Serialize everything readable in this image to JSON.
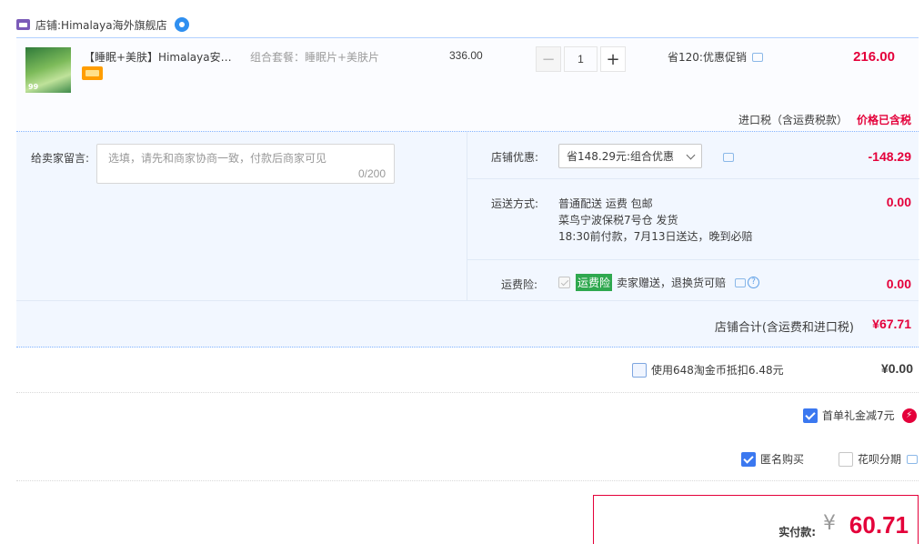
{
  "shop": {
    "prefix": "店铺:",
    "name": "Himalaya海外旗舰店"
  },
  "item": {
    "title": "【睡眠+美肤】Himalaya安神…",
    "sku": "组合套餐：睡眠片+美肤片",
    "unit_price": "336.00",
    "qty_minus": "−",
    "quantity": "1",
    "qty_plus": "+",
    "promo": "省120:优惠促销",
    "subtotal": "216.00",
    "tax_label": "进口税（含运费税款）",
    "tax_note": "价格已含税"
  },
  "order": {
    "message_label": "给卖家留言:",
    "message_placeholder": "选填，请先和商家协商一致，付款后商家可见",
    "message_count": "0/200",
    "discount_label": "店铺优惠:",
    "discount_selected": "省148.29元:组合优惠",
    "discount_amount": "-148.29",
    "shipping_label": "运送方式:",
    "shipping_line1": "普通配送 运费 包邮",
    "shipping_line2": "菜鸟宁波保税7号仓   发货",
    "shipping_line3": "18:30前付款，7月13日送达，晚到必赔",
    "shipping_amount": "0.00",
    "insurance_label": "运费险:",
    "insurance_tag": "运费险",
    "insurance_text": "卖家赠送，退换货可赔",
    "insurance_help": "?",
    "insurance_amount": "0.00",
    "total_label": "店铺合计(含运费和进口税)",
    "total_amount": "¥67.71"
  },
  "coins": {
    "label": "使用648淘金币抵扣6.48元",
    "amount": "¥0.00"
  },
  "gift": {
    "label": "首单礼金减7元",
    "icon": "⚡"
  },
  "options": {
    "anonymous": "匿名购买",
    "huabei": "花呗分期"
  },
  "payment": {
    "label": "实付款:",
    "currency": "¥",
    "amount": "60.71"
  },
  "colors": {
    "accent_red": "#e4003a",
    "checkbox_blue": "#3b78f0",
    "panel_bg": "#f2f7ff"
  }
}
